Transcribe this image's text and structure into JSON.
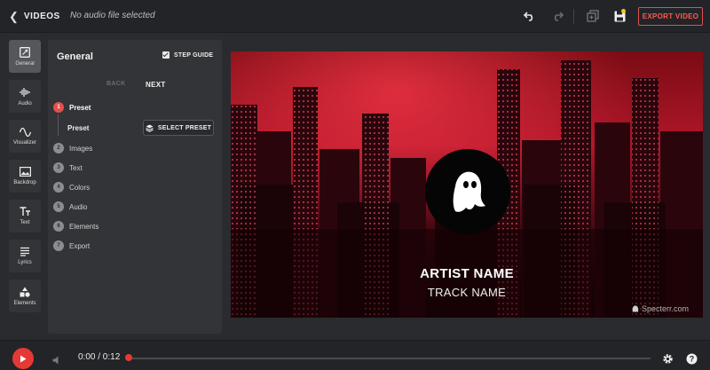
{
  "topbar": {
    "back_label": "VIDEOS",
    "audio_status": "No audio file selected",
    "export_label": "EXPORT VIDEO",
    "icons": [
      "undo-icon",
      "redo-icon",
      "duplicate-icon",
      "save-icon"
    ],
    "save_indicator_color": "#f5c518"
  },
  "leftnav": {
    "items": [
      {
        "label": "General",
        "icon": "general-icon",
        "active": true
      },
      {
        "label": "Audio",
        "icon": "audio-wave-icon"
      },
      {
        "label": "Visualizer",
        "icon": "visualizer-icon"
      },
      {
        "label": "Backdrop",
        "icon": "image-icon"
      },
      {
        "label": "Text",
        "icon": "text-icon"
      },
      {
        "label": "Lyrics",
        "icon": "lyrics-icon"
      },
      {
        "label": "Elements",
        "icon": "shapes-icon"
      }
    ]
  },
  "panel": {
    "title": "General",
    "step_guide_label": "STEP GUIDE",
    "step_guide_checked": true,
    "back_label": "BACK",
    "next_label": "NEXT",
    "steps": [
      {
        "num": "1",
        "label": "Preset",
        "active": true
      },
      {
        "num": "2",
        "label": "Images"
      },
      {
        "num": "3",
        "label": "Text"
      },
      {
        "num": "4",
        "label": "Colors"
      },
      {
        "num": "5",
        "label": "Audio"
      },
      {
        "num": "6",
        "label": "Elements"
      },
      {
        "num": "7",
        "label": "Export"
      }
    ],
    "preset_sub_label": "Preset",
    "select_preset_label": "SELECT PRESET"
  },
  "preview": {
    "artist_name": "ARTIST NAME",
    "track_name": "TRACK NAME",
    "watermark": "Specterr.com",
    "logo_icon": "ghost-icon"
  },
  "player": {
    "time": "0:00 / 0:12",
    "progress": 0.0,
    "accent_color": "#e53935"
  }
}
